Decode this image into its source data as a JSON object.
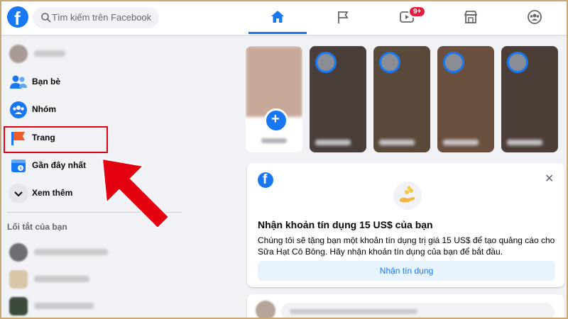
{
  "header": {
    "search_placeholder": "Tìm kiếm trên Facebook",
    "watch_badge": "9+"
  },
  "sidebar": {
    "items": [
      {
        "label": "Bạn bè"
      },
      {
        "label": "Nhóm"
      },
      {
        "label": "Trang"
      },
      {
        "label": "Gần đây nhất"
      },
      {
        "label": "Xem thêm"
      }
    ],
    "shortcuts_title": "Lối tắt của bạn"
  },
  "promo": {
    "title": "Nhận khoản tín dụng 15 US$ của bạn",
    "description": "Chúng tôi sẽ tặng bạn một khoản tín dụng trị giá 15 US$ để tạo quảng cáo cho Sữa Hạt Cô Bông. Hãy nhận khoản tín dụng của bạn để bắt đầu.",
    "button_label": "Nhận tín dụng"
  },
  "colors": {
    "brand": "#1877f2",
    "highlight": "#e3000f",
    "badge": "#e41e3f"
  }
}
